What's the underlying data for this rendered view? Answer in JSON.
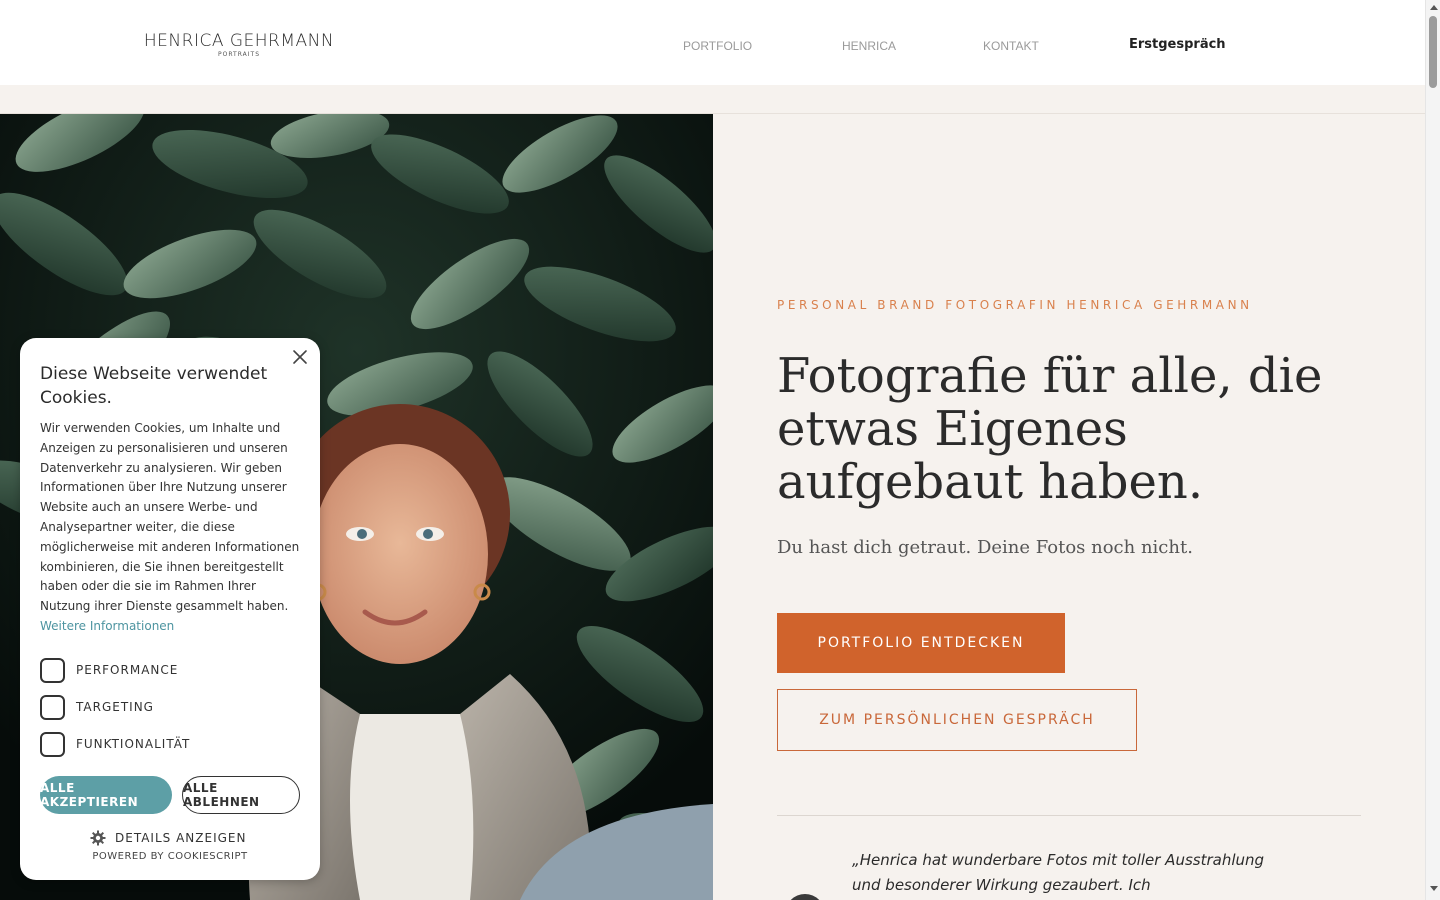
{
  "header": {
    "logo": {
      "name": "HENRICA GEHRMANN",
      "tagline": "PORTRAITS"
    },
    "nav": [
      {
        "label": "PORTFOLIO"
      },
      {
        "label": "HENRICA"
      },
      {
        "label": "KONTAKT"
      }
    ],
    "cta": "Erstgespräch"
  },
  "hero": {
    "eyebrow": "PERSONAL BRAND FOTOGRAFIN HENRICA GEHRMANN",
    "headline": "Fotografie für alle, die etwas Eigenes aufgebaut haben.",
    "subline": "Du hast dich getraut. Deine Fotos noch nicht.",
    "primary_button": "PORTFOLIO ENTDECKEN",
    "secondary_button": "ZUM PERSÖNLICHEN GESPRÄCH",
    "quote": "„Henrica hat wunderbare Fotos mit toller Ausstrahlung und besonderer Wirkung gezaubert. Ich"
  },
  "cookie": {
    "title": "Diese Webseite verwendet Cookies.",
    "body": "Wir verwenden Cookies, um Inhalte und Anzeigen zu personalisieren und unseren Datenverkehr zu analysieren. Wir geben Informationen über Ihre Nutzung unserer Website auch an unsere Werbe- und Analysepartner weiter, die diese möglicherweise mit anderen Informationen kombinieren, die Sie ihnen bereitgestellt haben oder die sie im Rahmen Ihrer Nutzung ihrer Dienste gesammelt haben.",
    "more_link": "Weitere Informationen",
    "checkboxes": [
      {
        "label": "PERFORMANCE"
      },
      {
        "label": "TARGETING"
      },
      {
        "label": "FUNKTIONALITÄT"
      }
    ],
    "accept": "ALLE AKZEPTIEREN",
    "decline": "ALLE ABLEHNEN",
    "details": "DETAILS ANZEIGEN",
    "powered_by": "POWERED BY COOKIESCRIPT"
  },
  "colors": {
    "accent": "#d0632c",
    "cream": "#f6f2ee",
    "cookie_teal": "#5d9fa6"
  }
}
